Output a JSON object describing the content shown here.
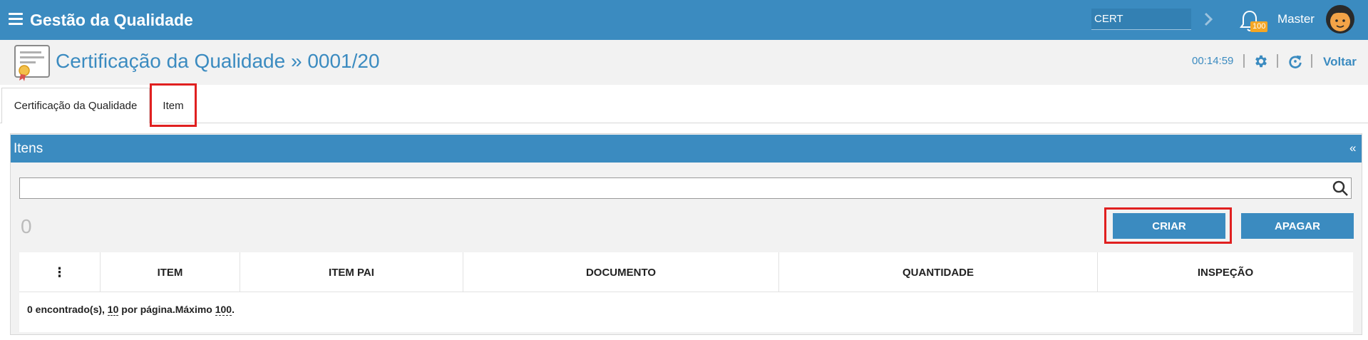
{
  "topbar": {
    "app_title": "Gestão da Qualidade",
    "module_code": "CERT",
    "notification_count": "100",
    "user_name": "Master",
    "bg_color": "#3b8bc0"
  },
  "header": {
    "page_title": "Certificação da Qualidade » 0001/20",
    "timer": "00:14:59",
    "back_label": "Voltar"
  },
  "tabs": [
    {
      "label": "Certificação da Qualidade"
    },
    {
      "label": "Item"
    }
  ],
  "panel": {
    "title": "Itens",
    "collapse_symbol": "«",
    "search_value": "",
    "record_count": "0",
    "buttons": {
      "create": "CRIAR",
      "delete": "APAGAR"
    }
  },
  "table": {
    "menu_symbol": "⋮",
    "columns": [
      "ITEM",
      "ITEM PAI",
      "DOCUMENTO",
      "QUANTIDADE",
      "INSPEÇÃO"
    ],
    "rows": [],
    "footer": {
      "found_text": "0 encontrado(s), ",
      "per_page": "10",
      "per_page_text": " por página.Máximo ",
      "max": "100",
      "end": "."
    }
  }
}
